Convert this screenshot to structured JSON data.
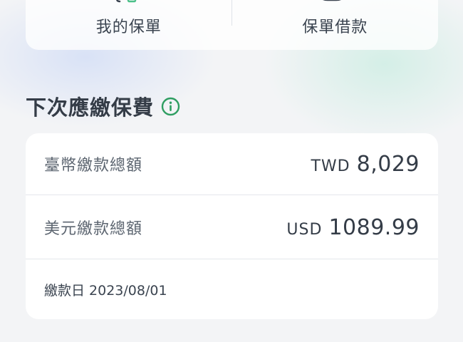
{
  "quick_actions": {
    "my_policy_label": "我的保單",
    "policy_loan_label": "保單借款"
  },
  "next_premium": {
    "title": "下次應繳保費",
    "info_icon": "info-circle-icon",
    "twd": {
      "label": "臺幣繳款總額",
      "currency": "TWD",
      "amount": "8,029"
    },
    "usd": {
      "label": "美元繳款總額",
      "currency": "USD",
      "amount": "1089.99"
    },
    "due_date": "繳款日 2023/08/01"
  },
  "colors": {
    "accent_green": "#2f9e62",
    "text_dark": "#343c47",
    "text_muted": "#5c6570",
    "card_bg": "#ffffff",
    "page_bg": "#f3f4f6"
  }
}
